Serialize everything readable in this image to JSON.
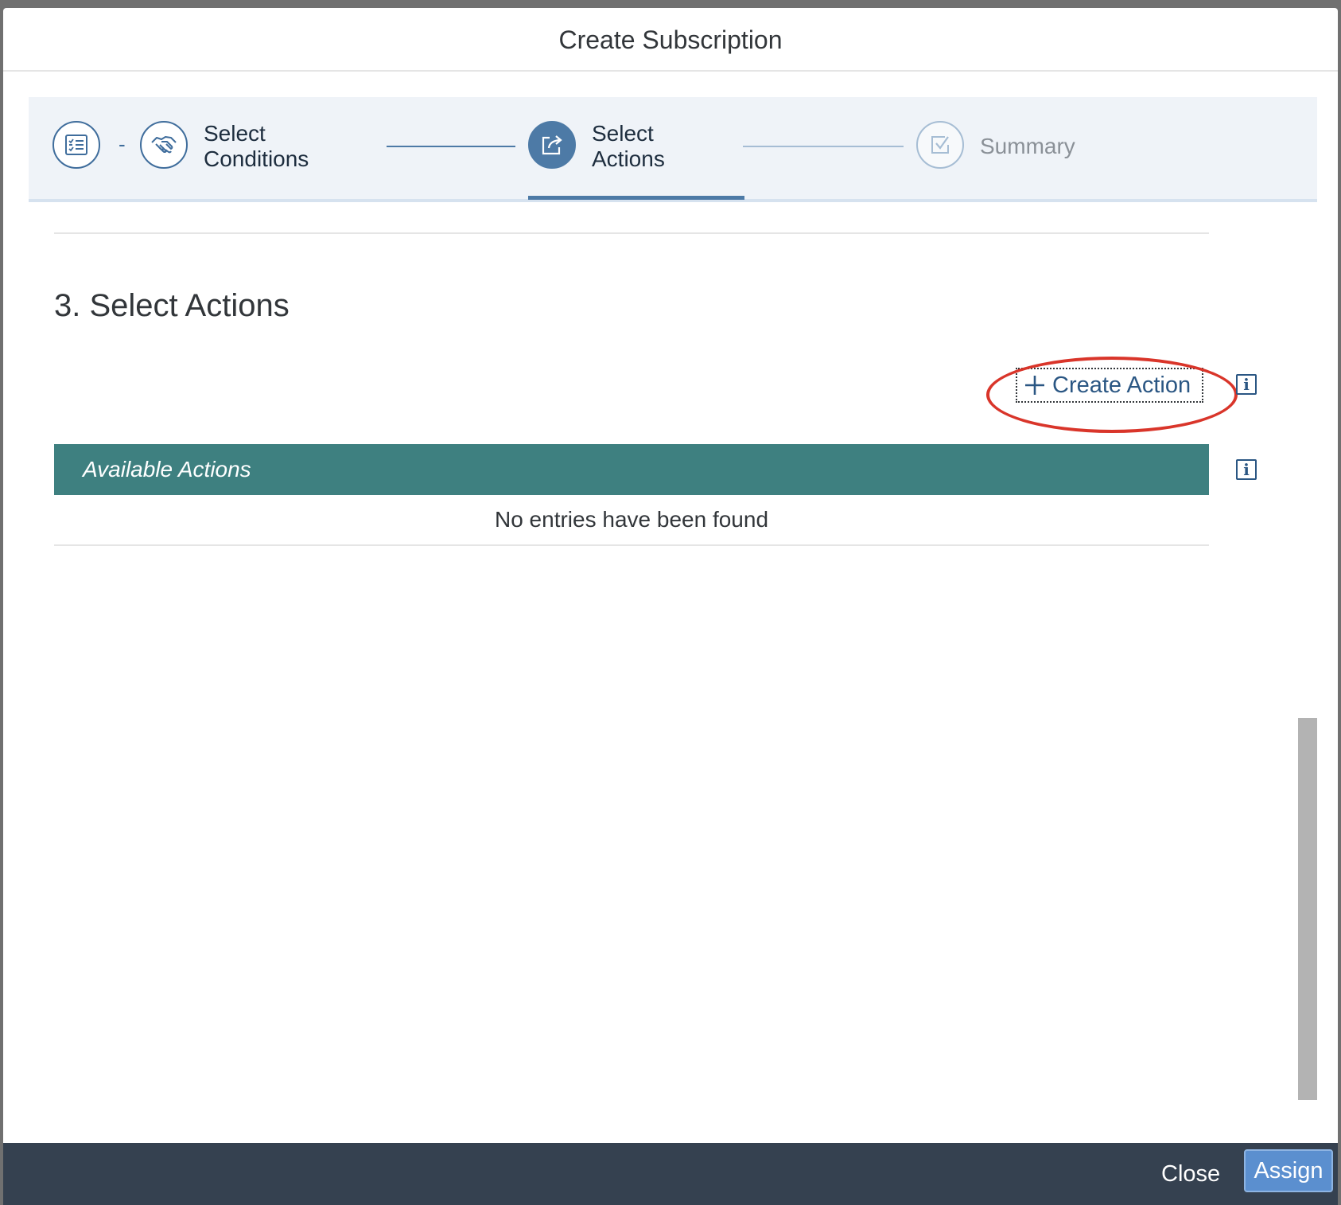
{
  "dialog": {
    "title": "Create Subscription"
  },
  "wizard": {
    "steps": [
      {
        "label": "",
        "icon": "checklist-icon",
        "state": "completed"
      },
      {
        "label": "Select\nConditions",
        "icon": "handshake-icon",
        "state": "completed"
      },
      {
        "label": "Select\nActions",
        "icon": "share-icon",
        "state": "active"
      },
      {
        "label": "Summary",
        "icon": "checkbox-icon",
        "state": "disabled"
      }
    ],
    "separator_dash": "-"
  },
  "section": {
    "title": "3. Select Actions"
  },
  "toolbar": {
    "create_action_label": "Create Action",
    "info_glyph": "i"
  },
  "table": {
    "header": "Available Actions",
    "empty_text": "No entries have been found",
    "info_glyph": "i"
  },
  "footer": {
    "close_label": "Close",
    "assign_label": "Assign"
  },
  "colors": {
    "accent": "#4d7aa6",
    "table_header": "#3e8080",
    "footer_bg": "#354150",
    "assign_button": "#5b8fcf",
    "highlight": "#d9352a"
  }
}
